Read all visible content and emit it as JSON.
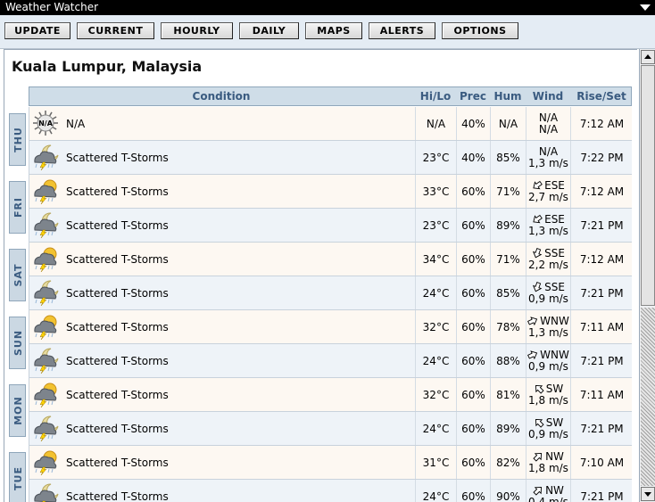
{
  "app": {
    "title": "Weather Watcher"
  },
  "toolbar": {
    "buttons": [
      {
        "label": "UPDATE"
      },
      {
        "label": "CURRENT"
      },
      {
        "label": "HOURLY"
      },
      {
        "label": "DAILY"
      },
      {
        "label": "MAPS"
      },
      {
        "label": "ALERTS"
      },
      {
        "label": "OPTIONS"
      }
    ]
  },
  "location": "Kuala Lumpur, Malaysia",
  "table": {
    "headers": {
      "condition": "Condition",
      "hilo": "Hi/Lo",
      "prec": "Prec",
      "hum": "Hum",
      "wind": "Wind",
      "riseset": "Rise/Set"
    },
    "days": [
      "THU",
      "FRI",
      "SAT",
      "SUN",
      "MON",
      "TUE"
    ],
    "rows": [
      {
        "icon": "na-icon",
        "condition": "N/A",
        "hilo": "N/A",
        "prec": "40%",
        "hum": "N/A",
        "wind_dir": "N/A",
        "wind_speed": "N/A",
        "arrow": "none",
        "riseset": "7:12 AM"
      },
      {
        "icon": "thunderstorm-night-icon",
        "condition": "Scattered T-Storms",
        "hilo": "23°C",
        "prec": "40%",
        "hum": "85%",
        "wind_dir": "N/A",
        "wind_speed": "1,3 m/s",
        "arrow": "none",
        "riseset": "7:22 PM"
      },
      {
        "icon": "thunderstorm-day-icon",
        "condition": "Scattered T-Storms",
        "hilo": "33°C",
        "prec": "60%",
        "hum": "71%",
        "wind_dir": "ESE",
        "wind_speed": "2,7 m/s",
        "arrow": "wind-arrow-ese-icon",
        "riseset": "7:12 AM"
      },
      {
        "icon": "thunderstorm-night-icon",
        "condition": "Scattered T-Storms",
        "hilo": "23°C",
        "prec": "60%",
        "hum": "89%",
        "wind_dir": "ESE",
        "wind_speed": "1,3 m/s",
        "arrow": "wind-arrow-ese-icon",
        "riseset": "7:21 PM"
      },
      {
        "icon": "thunderstorm-day-icon",
        "condition": "Scattered T-Storms",
        "hilo": "34°C",
        "prec": "60%",
        "hum": "71%",
        "wind_dir": "SSE",
        "wind_speed": "2,2 m/s",
        "arrow": "wind-arrow-sse-icon",
        "riseset": "7:12 AM"
      },
      {
        "icon": "thunderstorm-night-icon",
        "condition": "Scattered T-Storms",
        "hilo": "24°C",
        "prec": "60%",
        "hum": "85%",
        "wind_dir": "SSE",
        "wind_speed": "0,9 m/s",
        "arrow": "wind-arrow-sse-icon",
        "riseset": "7:21 PM"
      },
      {
        "icon": "thunderstorm-day-icon",
        "condition": "Scattered T-Storms",
        "hilo": "32°C",
        "prec": "60%",
        "hum": "78%",
        "wind_dir": "WNW",
        "wind_speed": "1,3 m/s",
        "arrow": "wind-arrow-wnw-icon",
        "riseset": "7:11 AM"
      },
      {
        "icon": "thunderstorm-night-icon",
        "condition": "Scattered T-Storms",
        "hilo": "24°C",
        "prec": "60%",
        "hum": "88%",
        "wind_dir": "WNW",
        "wind_speed": "0,9 m/s",
        "arrow": "wind-arrow-wnw-icon",
        "riseset": "7:21 PM"
      },
      {
        "icon": "thunderstorm-day-icon",
        "condition": "Scattered T-Storms",
        "hilo": "32°C",
        "prec": "60%",
        "hum": "81%",
        "wind_dir": "SW",
        "wind_speed": "1,8 m/s",
        "arrow": "wind-arrow-sw-icon",
        "riseset": "7:11 AM"
      },
      {
        "icon": "thunderstorm-night-icon",
        "condition": "Scattered T-Storms",
        "hilo": "24°C",
        "prec": "60%",
        "hum": "89%",
        "wind_dir": "SW",
        "wind_speed": "0,9 m/s",
        "arrow": "wind-arrow-sw-icon",
        "riseset": "7:21 PM"
      },
      {
        "icon": "thunderstorm-day-icon",
        "condition": "Scattered T-Storms",
        "hilo": "31°C",
        "prec": "60%",
        "hum": "82%",
        "wind_dir": "NW",
        "wind_speed": "1,8 m/s",
        "arrow": "wind-arrow-nw-icon",
        "riseset": "7:10 AM"
      },
      {
        "icon": "thunderstorm-night-icon",
        "condition": "Scattered T-Storms",
        "hilo": "24°C",
        "prec": "60%",
        "hum": "90%",
        "wind_dir": "NW",
        "wind_speed": "0,4 m/s",
        "arrow": "wind-arrow-nw-icon",
        "riseset": "7:21 PM"
      }
    ]
  },
  "colors": {
    "header_text": "#3a5b80",
    "row_odd": "#fdf8f2",
    "row_even": "#eef3f8",
    "titlebar": "#000000"
  }
}
